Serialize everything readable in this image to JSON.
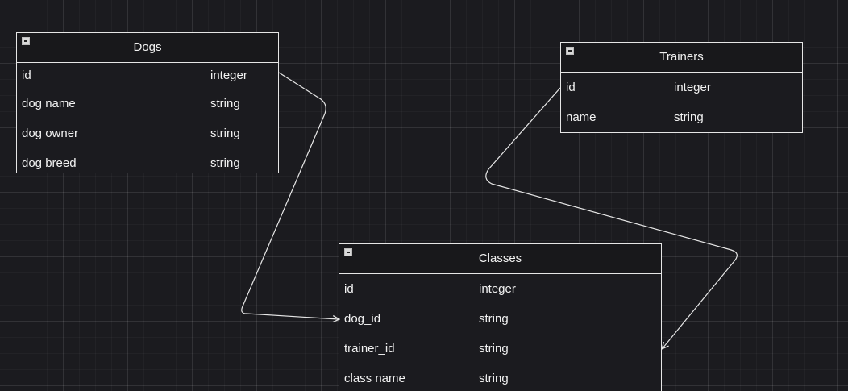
{
  "tables": {
    "dogs": {
      "title": "Dogs",
      "rows": [
        {
          "name": "id",
          "type": "integer"
        },
        {
          "name": "dog name",
          "type": "string"
        },
        {
          "name": "dog owner",
          "type": "string"
        },
        {
          "name": "dog breed",
          "type": "string"
        }
      ]
    },
    "trainers": {
      "title": "Trainers",
      "rows": [
        {
          "name": "id",
          "type": "integer"
        },
        {
          "name": "name",
          "type": "string"
        }
      ]
    },
    "classes": {
      "title": "Classes",
      "rows": [
        {
          "name": "id",
          "type": "integer"
        },
        {
          "name": "dog_id",
          "type": "string"
        },
        {
          "name": "trainer_id",
          "type": "string"
        },
        {
          "name": "class name",
          "type": "string"
        }
      ]
    }
  },
  "connectors": [
    {
      "from": "Dogs.id",
      "to": "Classes.dog_id"
    },
    {
      "from": "Trainers.id",
      "to": "Classes.trainer_id"
    }
  ],
  "colors": {
    "background": "#1b1b1f",
    "line": "#e6e6e6",
    "text": "#f2f2f2"
  }
}
